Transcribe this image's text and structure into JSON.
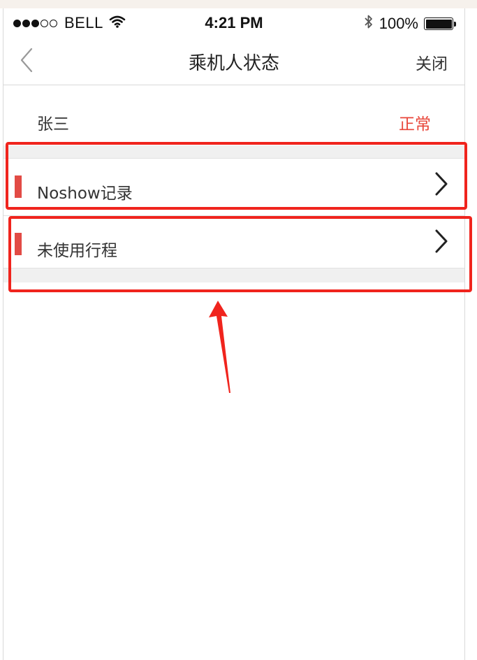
{
  "status_bar": {
    "signal_full": 3,
    "signal_total": 5,
    "carrier": "BELL",
    "time": "4:21 PM",
    "battery_percent": "100%",
    "icons": [
      "signal-dots-icon",
      "wifi-icon",
      "bluetooth-icon",
      "battery-icon"
    ]
  },
  "nav": {
    "back_icon": "chevron-left-icon",
    "title": "乘机人状态",
    "close_label": "关闭"
  },
  "passenger": {
    "name": "张三",
    "status": "正常",
    "status_color": "#e8463a"
  },
  "list": {
    "items": [
      {
        "label": "Noshow记录",
        "icon": "chevron-right-icon"
      },
      {
        "label": "未使用行程",
        "icon": "chevron-right-icon"
      }
    ],
    "marker_color": "#e24b45"
  },
  "annotations": {
    "color": "#f0241d",
    "boxes": 2,
    "arrow_icon": "up-arrow-icon"
  }
}
